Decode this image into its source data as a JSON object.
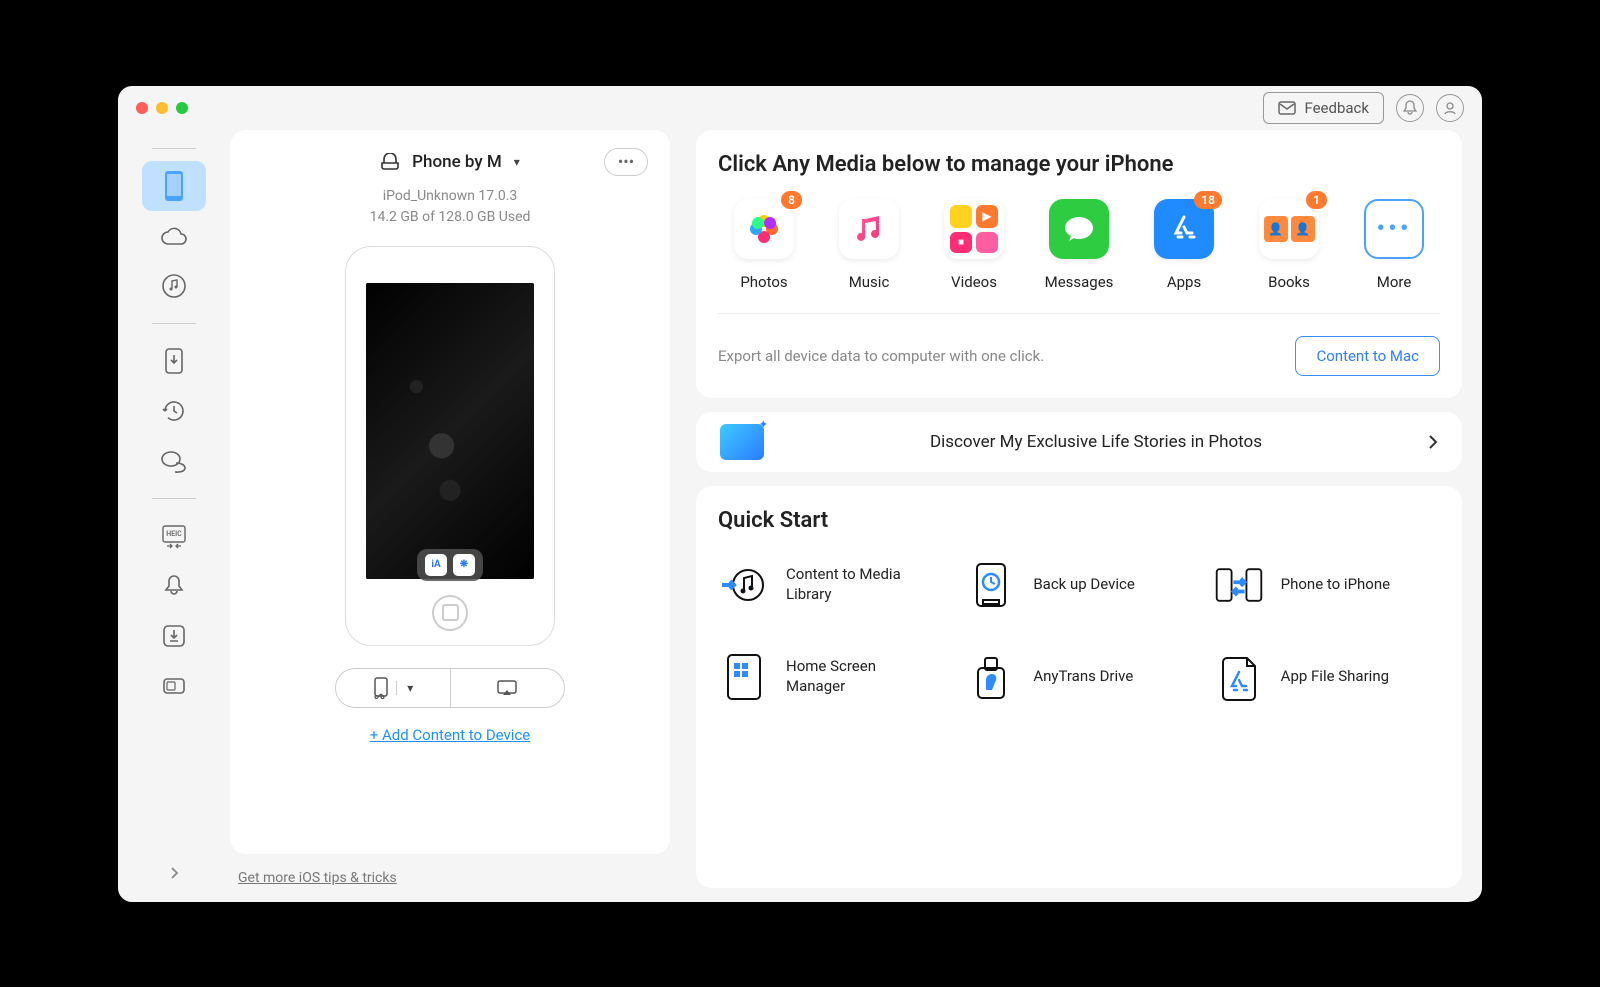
{
  "header": {
    "feedback": "Feedback"
  },
  "device": {
    "name": "Phone by M",
    "model_line": "iPod_Unknown 17.0.3",
    "storage_line": "14.2 GB of  128.0 GB Used",
    "add_content": "+ Add Content to Device"
  },
  "tips": {
    "link": "Get more iOS tips & tricks"
  },
  "main": {
    "media_title": "Click Any Media below to manage your iPhone",
    "export_text": "Export all device data to computer with one click.",
    "content_to_mac": "Content to Mac",
    "discover": "Discover My Exclusive Life Stories in Photos",
    "quick_start_title": "Quick Start",
    "media": [
      {
        "label": "Photos",
        "badge": "8",
        "bg": "#fff",
        "glyph": "photos"
      },
      {
        "label": "Music",
        "badge": null,
        "bg": "#fff",
        "glyph": "music"
      },
      {
        "label": "Videos",
        "badge": null,
        "bg": "#fff",
        "glyph": "videos"
      },
      {
        "label": "Messages",
        "badge": null,
        "bg": "#2ecc40",
        "glyph": "messages"
      },
      {
        "label": "Apps",
        "badge": "18",
        "bg": "#1f8bff",
        "glyph": "apps"
      },
      {
        "label": "Books",
        "badge": "1",
        "bg": "#fff",
        "glyph": "books"
      },
      {
        "label": "More",
        "badge": null,
        "bg": "more",
        "glyph": "more"
      }
    ],
    "quick": [
      {
        "label": "Content to Media Library"
      },
      {
        "label": "Back up Device"
      },
      {
        "label": "Phone to iPhone"
      },
      {
        "label": "Home Screen Manager"
      },
      {
        "label": "AnyTrans Drive"
      },
      {
        "label": "App File Sharing"
      }
    ]
  }
}
